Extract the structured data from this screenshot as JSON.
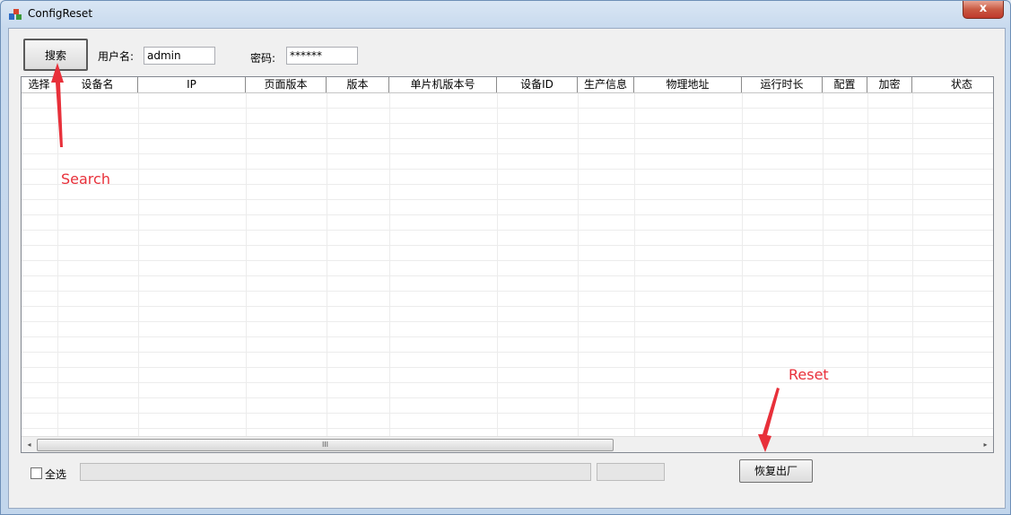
{
  "window": {
    "title": "ConfigReset",
    "close_label": "x"
  },
  "toolbar": {
    "search_label": "搜索",
    "username_label": "用户名:",
    "username_value": "admin",
    "password_label": "密码:",
    "password_value": "******"
  },
  "table": {
    "columns": [
      "选择",
      "设备名",
      "IP",
      "页面版本",
      "版本",
      "单片机版本号",
      "设备ID",
      "生产信息",
      "物理地址",
      "运行时长",
      "配置",
      "加密",
      "状态"
    ],
    "rows": []
  },
  "scrollbar": {
    "left_arrow": "◂",
    "right_arrow": "▸",
    "thumb_grip": "III"
  },
  "footer": {
    "select_all_label": "全选",
    "reset_label": "恢复出厂"
  },
  "annotations": {
    "search": "Search",
    "reset": "Reset",
    "color": "#e8303a"
  }
}
